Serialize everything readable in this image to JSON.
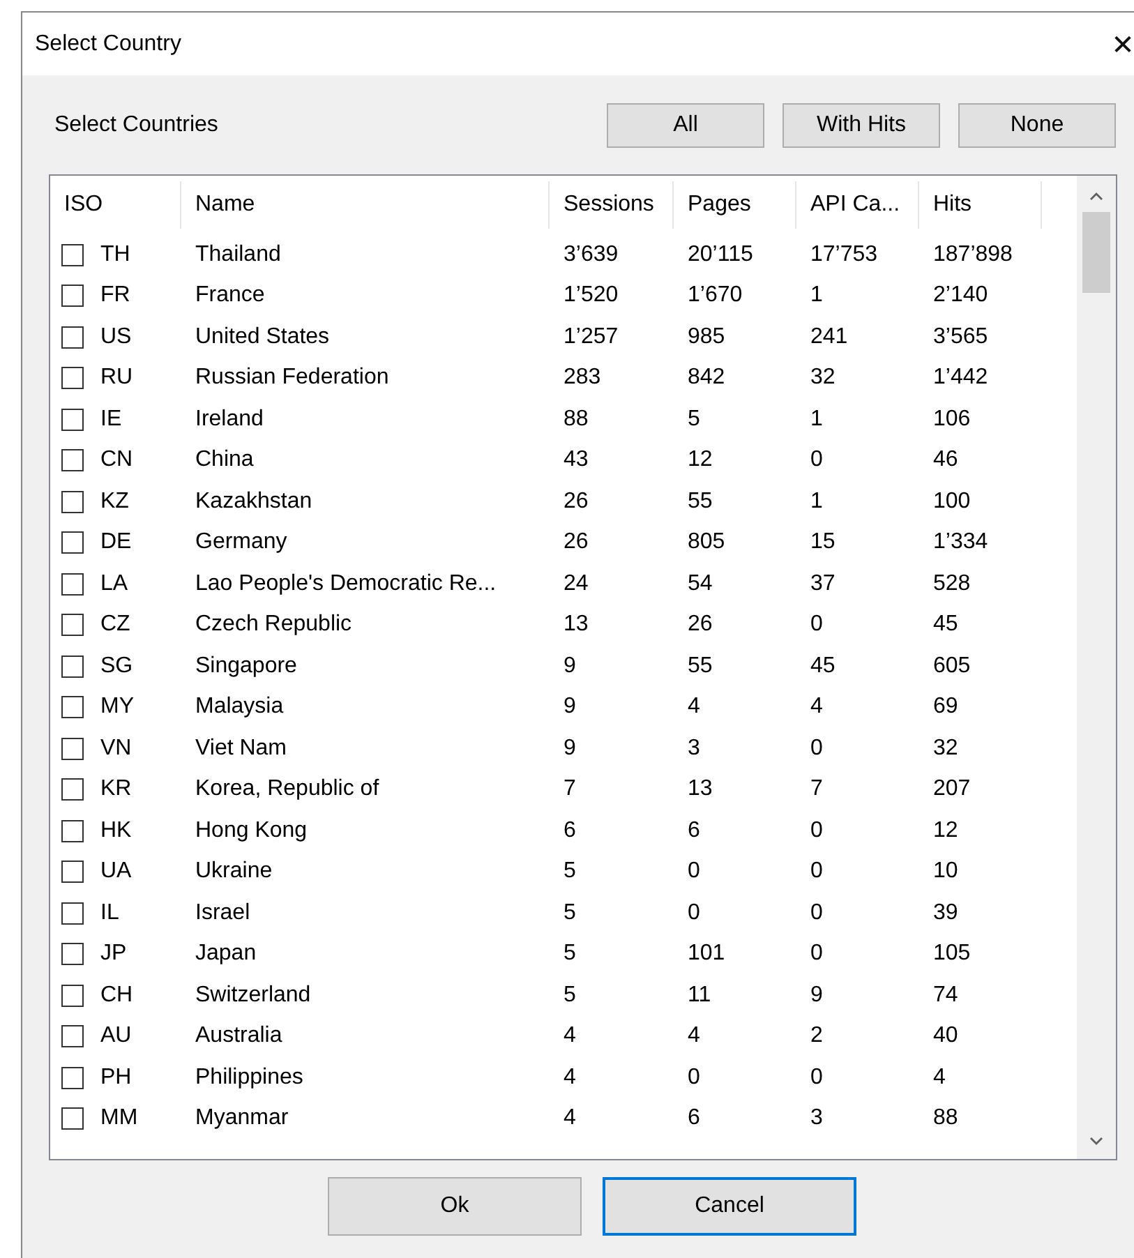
{
  "window": {
    "title": "Select Country",
    "close": "✕"
  },
  "header": {
    "label": "Select Countries",
    "buttons": [
      "All",
      "With Hits",
      "None"
    ]
  },
  "table": {
    "columns": [
      "ISO",
      "Name",
      "Sessions",
      "Pages",
      "API Ca...",
      "Hits"
    ],
    "rows": [
      {
        "checked": false,
        "cells": [
          "TH",
          "Thailand",
          "3’639",
          "20’115",
          "17’753",
          "187’898"
        ]
      },
      {
        "checked": false,
        "cells": [
          "FR",
          "France",
          "1’520",
          "1’670",
          "1",
          "2’140"
        ]
      },
      {
        "checked": false,
        "cells": [
          "US",
          "United States",
          "1’257",
          "985",
          "241",
          "3’565"
        ]
      },
      {
        "checked": false,
        "cells": [
          "RU",
          "Russian Federation",
          "283",
          "842",
          "32",
          "1’442"
        ]
      },
      {
        "checked": false,
        "cells": [
          "IE",
          "Ireland",
          "88",
          "5",
          "1",
          "106"
        ]
      },
      {
        "checked": false,
        "cells": [
          "CN",
          "China",
          "43",
          "12",
          "0",
          "46"
        ]
      },
      {
        "checked": false,
        "cells": [
          "KZ",
          "Kazakhstan",
          "26",
          "55",
          "1",
          "100"
        ]
      },
      {
        "checked": false,
        "cells": [
          "DE",
          "Germany",
          "26",
          "805",
          "15",
          "1’334"
        ]
      },
      {
        "checked": false,
        "cells": [
          "LA",
          "Lao People's Democratic Re...",
          "24",
          "54",
          "37",
          "528"
        ]
      },
      {
        "checked": false,
        "cells": [
          "CZ",
          "Czech Republic",
          "13",
          "26",
          "0",
          "45"
        ]
      },
      {
        "checked": false,
        "cells": [
          "SG",
          "Singapore",
          "9",
          "55",
          "45",
          "605"
        ]
      },
      {
        "checked": false,
        "cells": [
          "MY",
          "Malaysia",
          "9",
          "4",
          "4",
          "69"
        ]
      },
      {
        "checked": false,
        "cells": [
          "VN",
          "Viet Nam",
          "9",
          "3",
          "0",
          "32"
        ]
      },
      {
        "checked": false,
        "cells": [
          "KR",
          "Korea, Republic of",
          "7",
          "13",
          "7",
          "207"
        ]
      },
      {
        "checked": false,
        "cells": [
          "HK",
          "Hong Kong",
          "6",
          "6",
          "0",
          "12"
        ]
      },
      {
        "checked": false,
        "cells": [
          "UA",
          "Ukraine",
          "5",
          "0",
          "0",
          "10"
        ]
      },
      {
        "checked": false,
        "cells": [
          "IL",
          "Israel",
          "5",
          "0",
          "0",
          "39"
        ]
      },
      {
        "checked": false,
        "cells": [
          "JP",
          "Japan",
          "5",
          "101",
          "0",
          "105"
        ]
      },
      {
        "checked": false,
        "cells": [
          "CH",
          "Switzerland",
          "5",
          "11",
          "9",
          "74"
        ]
      },
      {
        "checked": false,
        "cells": [
          "AU",
          "Australia",
          "4",
          "4",
          "2",
          "40"
        ]
      },
      {
        "checked": false,
        "cells": [
          "PH",
          "Philippines",
          "4",
          "0",
          "0",
          "4"
        ]
      },
      {
        "checked": false,
        "cells": [
          "MM",
          "Myanmar",
          "4",
          "6",
          "3",
          "88"
        ]
      }
    ]
  },
  "footer": {
    "buttons": [
      {
        "label": "Ok",
        "default": false
      },
      {
        "label": "Cancel",
        "default": true
      }
    ]
  }
}
